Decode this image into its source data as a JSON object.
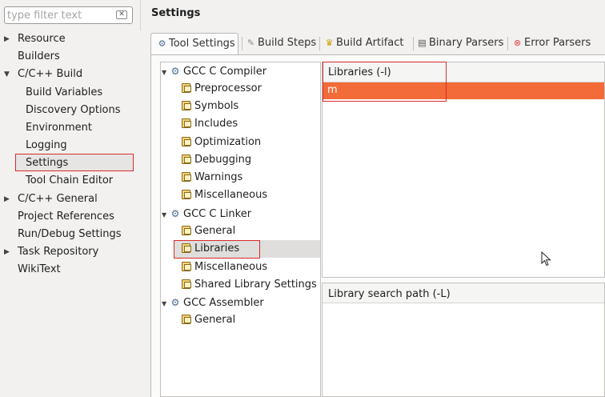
{
  "sidebar": {
    "filter_placeholder": "type filter text",
    "items": [
      {
        "label": "Resource",
        "expanded": false
      },
      {
        "label": "Builders"
      },
      {
        "label": "C/C++ Build",
        "expanded": true
      },
      {
        "label": "Build Variables"
      },
      {
        "label": "Discovery Options"
      },
      {
        "label": "Environment"
      },
      {
        "label": "Logging"
      },
      {
        "label": "Settings",
        "selected": true
      },
      {
        "label": "Tool Chain Editor"
      },
      {
        "label": "C/C++ General",
        "expanded": false
      },
      {
        "label": "Project References"
      },
      {
        "label": "Run/Debug Settings"
      },
      {
        "label": "Task Repository",
        "expanded": false
      },
      {
        "label": "WikiText"
      }
    ]
  },
  "header": {
    "title": "Settings"
  },
  "tabs": [
    {
      "label": "Tool Settings",
      "icon": "tool-settings-icon",
      "active": true
    },
    {
      "label": "Build Steps",
      "icon": "build-steps-icon"
    },
    {
      "label": "Build Artifact",
      "icon": "build-artifact-icon"
    },
    {
      "label": "Binary Parsers",
      "icon": "binary-parsers-icon"
    },
    {
      "label": "Error Parsers",
      "icon": "error-parsers-icon"
    }
  ],
  "tree": [
    {
      "label": "GCC C Compiler",
      "type": "tool"
    },
    {
      "label": "Preprocessor",
      "type": "option"
    },
    {
      "label": "Symbols",
      "type": "option"
    },
    {
      "label": "Includes",
      "type": "option"
    },
    {
      "label": "Optimization",
      "type": "option"
    },
    {
      "label": "Debugging",
      "type": "option"
    },
    {
      "label": "Warnings",
      "type": "option"
    },
    {
      "label": "Miscellaneous",
      "type": "option"
    },
    {
      "label": "GCC C Linker",
      "type": "tool"
    },
    {
      "label": "General",
      "type": "option"
    },
    {
      "label": "Libraries",
      "type": "option",
      "selected": true
    },
    {
      "label": "Miscellaneous",
      "type": "option"
    },
    {
      "label": "Shared Library Settings",
      "type": "option"
    },
    {
      "label": "GCC Assembler",
      "type": "tool"
    },
    {
      "label": "General",
      "type": "option"
    }
  ],
  "libraries": {
    "header": "Libraries (-l)",
    "items": [
      "m"
    ]
  },
  "library_paths": {
    "header": "Library search path (-L)",
    "items": []
  },
  "colors": {
    "selection": "#f26b38",
    "highlight_box": "#d92b2b"
  }
}
